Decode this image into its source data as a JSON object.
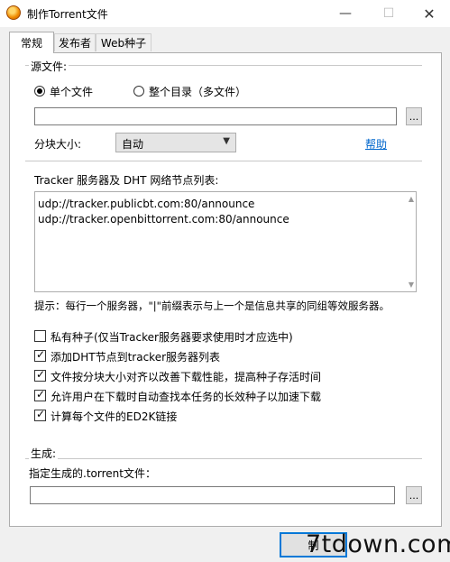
{
  "window": {
    "title": "制作Torrent文件",
    "minimize": "—",
    "maximize": "☐",
    "close": "✕"
  },
  "tabs": [
    {
      "label": "常规",
      "active": true
    },
    {
      "label": "发布者",
      "active": false
    },
    {
      "label": "Web种子",
      "active": false
    }
  ],
  "source": {
    "group_label": "源文件:",
    "radio_single": "单个文件",
    "radio_dir": "整个目录（多文件）",
    "selected": "single",
    "path_value": "",
    "browse_label": "...",
    "chunk_label": "分块大小:",
    "chunk_value": "自动",
    "help_link": "帮助"
  },
  "tracker": {
    "label": "Tracker 服务器及 DHT 网络节点列表:",
    "lines": [
      "udp://tracker.publicbt.com:80/announce",
      "udp://tracker.openbittorrent.com:80/announce"
    ],
    "hint": "提示：每行一个服务器，\"|\"前缀表示与上一个是信息共享的同组等效服务器。"
  },
  "options": [
    {
      "label": "私有种子(仅当Tracker服务器要求使用时才应选中)",
      "checked": false
    },
    {
      "label": "添加DHT节点到tracker服务器列表",
      "checked": true
    },
    {
      "label": "文件按分块大小对齐以改善下载性能，提高种子存活时间",
      "checked": true
    },
    {
      "label": "允许用户在下载时自动查找本任务的长效种子以加速下载",
      "checked": true
    },
    {
      "label": "计算每个文件的ED2K链接",
      "checked": true
    }
  ],
  "output": {
    "group_label": "生成:",
    "label": "指定生成的.torrent文件：",
    "path_value": "",
    "browse_label": "..."
  },
  "footer": {
    "make_button": "制",
    "watermark": "7tdown.com"
  }
}
